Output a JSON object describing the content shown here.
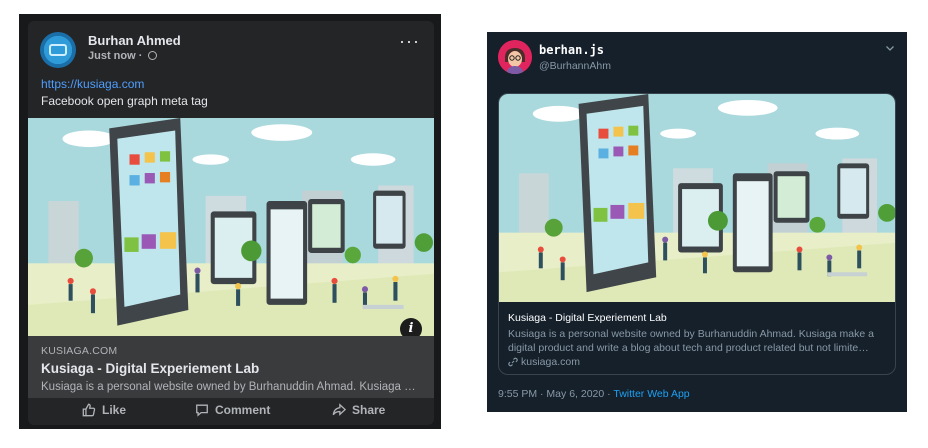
{
  "facebook": {
    "author": "Burhan Ahmed",
    "time": "Just now ·",
    "more_label": "···",
    "link": "https://kusiaga.com",
    "caption": "Facebook open graph meta tag",
    "preview": {
      "domain": "KUSIAGA.COM",
      "title": "Kusiaga - Digital Experiement Lab",
      "description": "Kusiaga is a personal website owned by Burhanuddin Ahmad. Kusiaga make a digital product and write a blog about tech and product related"
    },
    "info_label": "i",
    "actions": {
      "like": "Like",
      "comment": "Comment",
      "share": "Share"
    },
    "colors": {
      "background": "#18191a",
      "card": "#242526",
      "link": "#4e9eff"
    }
  },
  "twitter": {
    "name": "berhan.js",
    "handle": "@BurhannAhm",
    "card": {
      "title": "Kusiaga - Digital Experiement Lab",
      "description": "Kusiaga is a personal website owned by Burhanuddin Ahmad. Kusiaga make a digital product and write a blog about tech and product related but not limite…",
      "domain": "kusiaga.com"
    },
    "timestamp": "9:55 PM · May 6, 2020 · ",
    "app": "Twitter Web App",
    "colors": {
      "background": "#15202b",
      "accent": "#1da1f2"
    }
  },
  "icons": [
    "globe-icon",
    "more-icon",
    "info-icon",
    "like-icon",
    "comment-icon",
    "share-icon",
    "chevron-down-icon",
    "link-icon"
  ]
}
